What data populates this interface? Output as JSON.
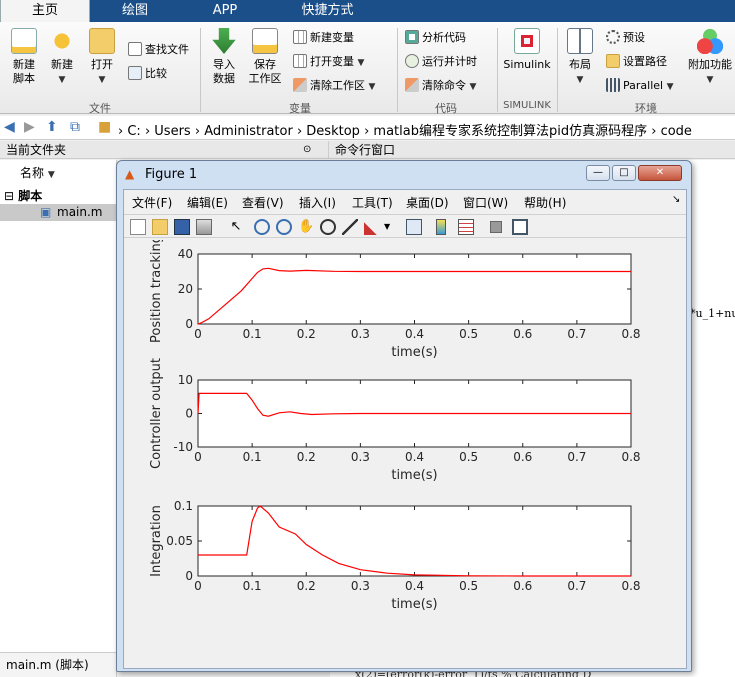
{
  "ribbon_tabs": [
    "主页",
    "绘图",
    "APP",
    "快捷方式"
  ],
  "ribbon": {
    "file_section": {
      "label": "文件",
      "new_script": "新建\n脚本",
      "new": "新建",
      "open": "打开",
      "find_files": "查找文件",
      "compare": "比较"
    },
    "variable_section": {
      "label": "变量",
      "import": "导入\n数据",
      "save_workspace": "保存\n工作区",
      "new_variable": "新建变量",
      "open_variable": "打开变量",
      "clear_workspace": "清除工作区"
    },
    "code_section": {
      "label": "代码",
      "analyze": "分析代码",
      "run_time": "运行并计时",
      "clear_commands": "清除命令"
    },
    "simulink_section": {
      "label": "SIMULINK",
      "simulink": "Simulink"
    },
    "env_section": {
      "label": "环境",
      "layout": "布局",
      "preferences": "预设",
      "set_path": "设置路径",
      "parallel": "Parallel",
      "addons": "附加功能"
    }
  },
  "address": {
    "path": [
      "C:",
      "Users",
      "Administrator",
      "Desktop",
      "matlab编程专家系统控制算法pid仿真源码程序",
      "code"
    ]
  },
  "current_folder": {
    "title": "当前文件夹",
    "column_name": "名称",
    "group": "脚本",
    "file": "main.m",
    "status": "main.m  (脚本)"
  },
  "command_window": {
    "title": "命令行窗口",
    "snippet_right": "*u_1+nu",
    "snippet_bottom": "x(2)=(error(k)-error_1)/ts     % Calculating D"
  },
  "figure": {
    "title": "Figure 1",
    "menus": [
      "文件(F)",
      "编辑(E)",
      "查看(V)",
      "插入(I)",
      "工具(T)",
      "桌面(D)",
      "窗口(W)",
      "帮助(H)"
    ],
    "toolbar_icons": [
      "new-figure-icon",
      "open-icon",
      "save-icon",
      "print-icon",
      "pointer-icon",
      "zoom-in-icon",
      "zoom-out-icon",
      "pan-icon",
      "rotate-icon",
      "data-cursor-icon",
      "brush-icon",
      "link-icon",
      "colorbar-icon",
      "legend-icon",
      "hide-tools-icon",
      "show-tools-icon"
    ]
  },
  "colors": {
    "line": "#ff0000",
    "tabbar": "#1b4f8a"
  },
  "chart_data": [
    {
      "type": "line",
      "title": "",
      "xlabel": "time(s)",
      "ylabel": "Position tracking",
      "xlim": [
        0,
        0.8
      ],
      "ylim": [
        0,
        40
      ],
      "xticks": [
        0,
        0.1,
        0.2,
        0.3,
        0.4,
        0.5,
        0.6,
        0.7,
        0.8
      ],
      "yticks": [
        0,
        20,
        40
      ],
      "series": [
        {
          "x": [
            0,
            0.005,
            0.02,
            0.05,
            0.08,
            0.1,
            0.11,
            0.12,
            0.13,
            0.15,
            0.17,
            0.2,
            0.25,
            0.3,
            0.4,
            0.5,
            0.6,
            0.7,
            0.8
          ],
          "y": [
            0,
            0.5,
            3,
            11,
            19,
            26,
            29.5,
            31.5,
            31.8,
            30.5,
            30.2,
            30.6,
            30.1,
            30,
            30,
            30,
            30,
            30,
            30
          ]
        }
      ]
    },
    {
      "type": "line",
      "title": "",
      "xlabel": "time(s)",
      "ylabel": "Controller output",
      "xlim": [
        0,
        0.8
      ],
      "ylim": [
        -10,
        10
      ],
      "xticks": [
        0,
        0.1,
        0.2,
        0.3,
        0.4,
        0.5,
        0.6,
        0.7,
        0.8
      ],
      "yticks": [
        -10,
        0,
        10
      ],
      "series": [
        {
          "x": [
            0,
            0.002,
            0.09,
            0.1,
            0.11,
            0.12,
            0.13,
            0.15,
            0.17,
            0.19,
            0.21,
            0.25,
            0.3,
            0.4,
            0.5,
            0.6,
            0.7,
            0.8
          ],
          "y": [
            0,
            6,
            6,
            4,
            1.5,
            -0.5,
            -0.8,
            0.2,
            0.5,
            0,
            -0.3,
            -0.1,
            0,
            0,
            0,
            0,
            0,
            0
          ]
        }
      ]
    },
    {
      "type": "line",
      "title": "",
      "xlabel": "time(s)",
      "ylabel": "Integration",
      "xlim": [
        0,
        0.8
      ],
      "ylim": [
        0,
        0.1
      ],
      "xticks": [
        0,
        0.1,
        0.2,
        0.3,
        0.4,
        0.5,
        0.6,
        0.7,
        0.8
      ],
      "yticks": [
        0,
        0.05,
        0.1
      ],
      "series": [
        {
          "x": [
            0,
            0.09,
            0.1,
            0.11,
            0.115,
            0.13,
            0.15,
            0.18,
            0.2,
            0.23,
            0.26,
            0.3,
            0.35,
            0.4,
            0.5,
            0.6,
            0.7,
            0.8
          ],
          "y": [
            0.03,
            0.03,
            0.078,
            0.097,
            0.1,
            0.09,
            0.07,
            0.06,
            0.045,
            0.03,
            0.018,
            0.009,
            0.004,
            0.0015,
            0.0003,
            0,
            0,
            0
          ]
        }
      ]
    }
  ]
}
